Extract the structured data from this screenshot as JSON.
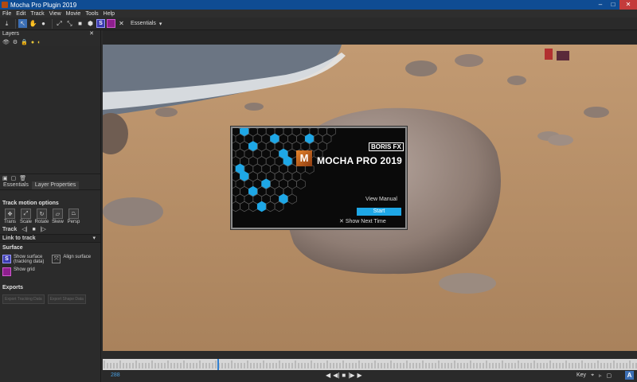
{
  "window": {
    "title": "Mocha Pro Plugin 2019",
    "minimize": "–",
    "maximize": "□",
    "close": "✕"
  },
  "menu": [
    "File",
    "Edit",
    "Track",
    "View",
    "Movie",
    "Tools",
    "Help"
  ],
  "toolbar": {
    "workspace": "Essentials",
    "surface_icon": "S"
  },
  "layers": {
    "title": "Layers",
    "close": "✕"
  },
  "tabs": [
    "Essentials",
    "Layer Properties"
  ],
  "essentials": {
    "track_motion_title": "Track motion options",
    "motion": [
      "Trans",
      "Scale",
      "Rotate",
      "Skew",
      "Persp"
    ],
    "track_label": "Track",
    "link_to_track": "Link to track",
    "surface_title": "Surface",
    "show_surface": "Show surface",
    "tracking_data": "(tracking data)",
    "align_surface": "Align surface",
    "show_grid": "Show grid",
    "exports_title": "Exports",
    "export_tracking": "Export Tracking Data",
    "export_shape": "Export Shape Data"
  },
  "splash": {
    "brand": "BORIS FX",
    "logo_letter": "M",
    "product": "MOCHA PRO 2019",
    "view_manual": "View Manual",
    "start": "Start",
    "show_next_time": "Show Next Time"
  },
  "timeline": {
    "frame": "288",
    "key_label": "Key"
  },
  "colors": {
    "accent": "#1ea7e6",
    "titlebar": "#0f4c93",
    "surface": "#3b3bb0",
    "grid": "#8e1f8e"
  }
}
